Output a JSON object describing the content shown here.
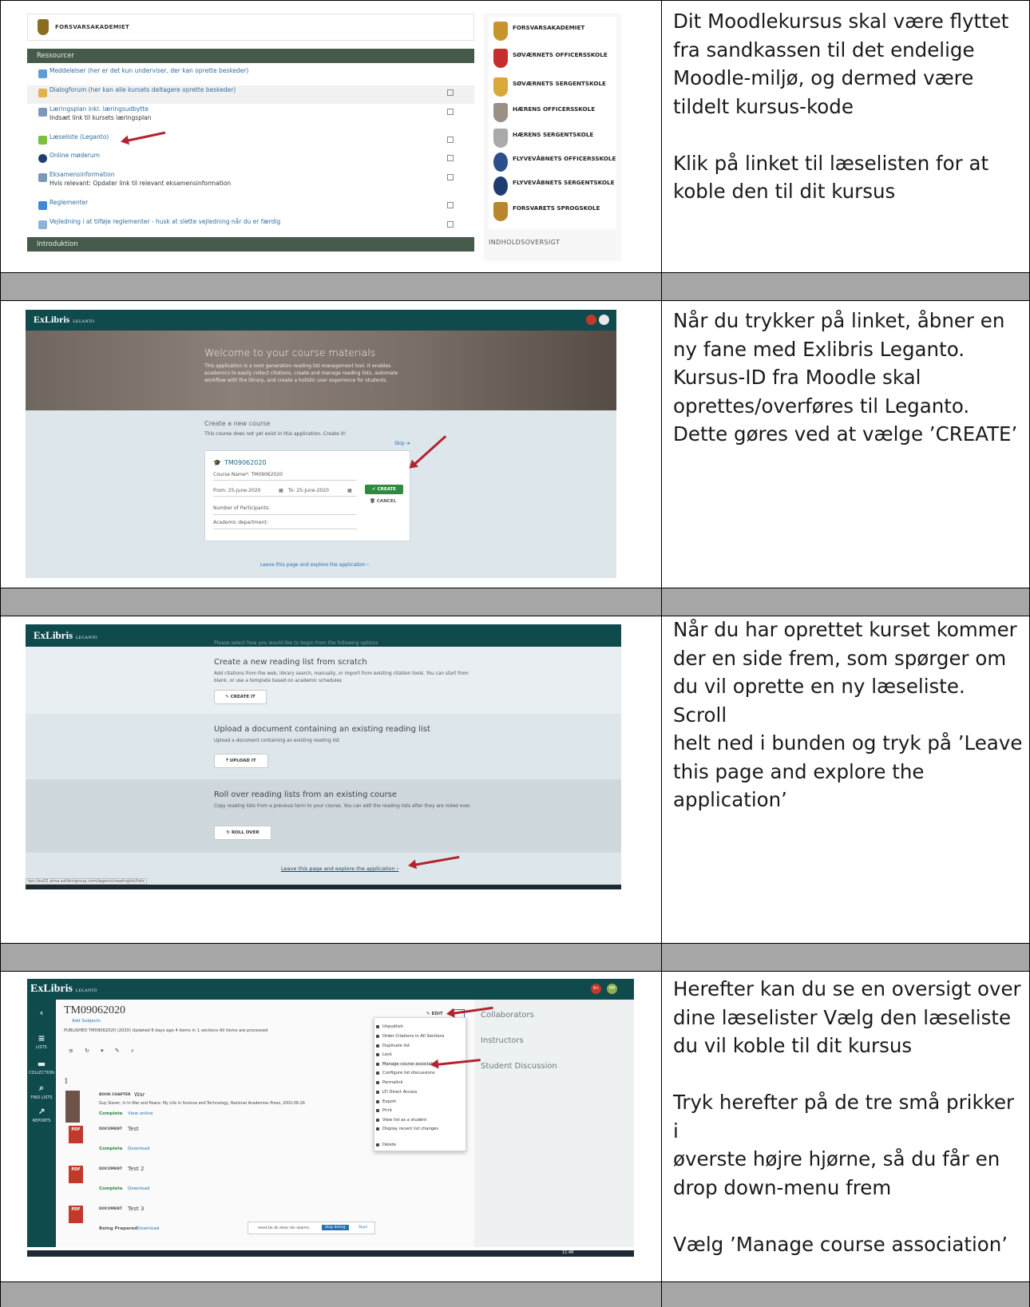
{
  "rows": [
    {
      "text_lines": [
        "Dit Moodlekursus skal være flyttet",
        "fra sandkassen til det endelige",
        "Moodle-miljø, og dermed være",
        "tildelt kursus-kode",
        "",
        "Klik på linket til læselisten for at",
        "koble den til dit kursus"
      ],
      "moodle": {
        "site_name": "FORSVARSAKADEMIET",
        "section_header": "Ressourcer",
        "items": [
          {
            "label": "Meddelelser (her er det kun underviser, der kan oprette beskeder)",
            "sub": ""
          },
          {
            "label": "Dialogforum (her kan alle kursets deltagere oprette beskeder)",
            "sub": ""
          },
          {
            "label": "Læringsplan inkl. læringsudbytte",
            "sub": "Indsæt link til kursets læringsplan"
          },
          {
            "label": "Læseliste (Leganto)",
            "sub": ""
          },
          {
            "label": "Online møderum",
            "sub": ""
          },
          {
            "label": "Eksamensinformation",
            "sub": "Hvis relevant: Opdater link til relevant eksamensinformation"
          },
          {
            "label": "Reglementer",
            "sub": ""
          },
          {
            "label": "Vejledning i at tilføje reglementer - husk at slette vejledning når du er færdig",
            "sub": ""
          }
        ],
        "next_section": "Introduktion",
        "schools": [
          "FORSVARSAKADEMIET",
          "SØVÆRNETS OFFICERSSKOLE",
          "SØVÆRNETS SERGENTSKOLE",
          "HÆRENS OFFICERSSKOLE",
          "HÆRENS SERGENTSKOLE",
          "FLYVEVÅBNETS OFFICERSSKOLE",
          "FLYVEVÅBNETS SERGENTSKOLE",
          "FORSVARETS SPROGSKOLE"
        ],
        "sidebar_footer": "INDHOLDSOVERSIGT"
      }
    },
    {
      "text_lines": [
        "Når du trykker på linket, åbner en",
        "ny fane med Exlibris Leganto.",
        "Kursus-ID fra Moodle skal",
        "oprettes/overføres til Leganto.",
        "Dette gøres ved at vælge ’CREATE’"
      ],
      "leganto": {
        "brand": "ExLibris",
        "brand_sub": "LEGANTO",
        "hero_title": "Welcome to your course materials",
        "hero_text": "This application is a next generation reading list management tool. It enables academics to easily collect citations, create and manage reading lists, automate workflow with the library, and create a holistic user experience for students.",
        "create_title": "Create a new course",
        "create_sub": "This course does not yet exist in this application. Create it!",
        "skip": "Skip ➔",
        "course_code": "TM09062020",
        "course_name_label": "Course Name*: TM09062020",
        "from_label": "From: 25-June-2020",
        "to_label": "To: 25-June-2020",
        "participants_label": "Number of Participants:",
        "department_label": "Academic department:",
        "create_btn": "✔ CREATE",
        "cancel_btn": "🗑 CANCEL",
        "leave_link": "Leave this page and explore the application ›"
      }
    },
    {
      "text_lines": [
        "Når du har oprettet kurset kommer",
        "der en side frem, som spørger om",
        "du vil oprette en ny læseliste. Scroll",
        "helt ned i bunden og tryk på ’Leave",
        "this page and explore the",
        "application’"
      ],
      "leganto_options": {
        "brand": "ExLibris",
        "brand_sub": "LEGANTO",
        "intro": "Please select how you would like to begin from the following options",
        "options": [
          {
            "title": "Create a new reading list from scratch",
            "text": "Add citations from the web, library search, manually, or import from existing citation tools. You can start from blank, or use a template based on academic schedules",
            "button": "✎ CREATE IT"
          },
          {
            "title": "Upload a document containing an existing reading list",
            "text": "Upload a document containing an existing reading list",
            "button": "⤒ UPLOAD IT"
          },
          {
            "title": "Roll over reading lists from an existing course",
            "text": "Copy reading lists from a previous term to your course. You can edit the reading lists after they are rolled over.",
            "button": "↻ ROLL OVER"
          }
        ],
        "leave_link": "Leave this page and explore the application ›",
        "status_url": "tps://eu02.alma.exlibrisgroup.com/leganto/readinglist/lists"
      }
    },
    {
      "text_lines": [
        "Herefter kan du se en oversigt over",
        "dine læselister Vælg den læseliste",
        "du vil koble til dit kursus",
        "",
        "Tryk herefter på de tre små prikker i",
        "øverste højre hjørne, så du får en",
        "drop down-menu frem",
        "",
        "Vælg ’Manage course association’"
      ],
      "leganto_list": {
        "brand": "ExLibris",
        "brand_sub": "LEGANTO",
        "avatar": "MP",
        "badge": "9+",
        "list_title": "TM09062020",
        "add_subjects": "Add Subjects",
        "meta": "PUBLISHED  TM09062020 (2020)  Updated 6 days ago  4 items in 1 sections  All items are processed",
        "edit_btn": "✎ EDIT",
        "section_label": "1",
        "nav": [
          "LISTS",
          "COLLECTION",
          "FIND LISTS",
          "REPORTS"
        ],
        "items": [
          {
            "type": "BOOK CHAPTER",
            "title": "War",
            "detail": "Guy Slever, in In War and Peace: My Life in Science and Technology, National Academies Press, 2002-06-26",
            "status": "Complete",
            "action": "View online"
          },
          {
            "type": "DOCUMENT",
            "title": "Test",
            "detail": "",
            "status": "Complete",
            "action": "Download"
          },
          {
            "type": "DOCUMENT",
            "title": "Test 2",
            "detail": "",
            "status": "Complete",
            "action": "Download"
          },
          {
            "type": "DOCUMENT",
            "title": "Test 3",
            "detail": "",
            "status": "Being Prepared",
            "action": "Download"
          }
        ],
        "menu": [
          "Unpublish",
          "Order Citations in All Sections",
          "Duplicate list",
          "Lock",
          "Manage course association",
          "Configure list discussions",
          "Permalink",
          "LTI Direct Access",
          "Export",
          "Print",
          "View list as a student",
          "Display recent list changes",
          "Delete"
        ],
        "panel": [
          "Collaborators",
          "Instructors",
          "Student Discussion"
        ],
        "share_bar": "meet.bk.dk deler din skærm.",
        "share_stop": "Stop deling",
        "share_hide": "Skjul",
        "clock": "11:46"
      }
    }
  ]
}
